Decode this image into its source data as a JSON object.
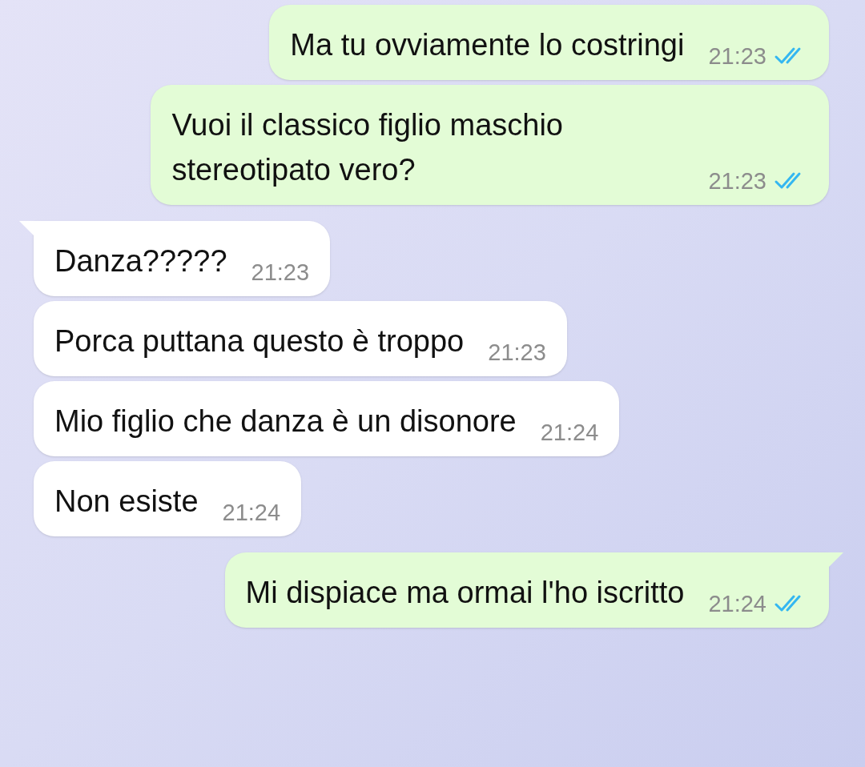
{
  "messages": [
    {
      "kind": "outgoing",
      "text": "Ma tu ovviamente lo costringi",
      "time": "21:23",
      "read": true,
      "tail": false
    },
    {
      "kind": "outgoing",
      "text": "Vuoi il classico figlio maschio stereotipato vero?",
      "time": "21:23",
      "read": true,
      "tail": false
    },
    {
      "kind": "incoming",
      "text": "Danza?????",
      "time": "21:23",
      "tail": true
    },
    {
      "kind": "incoming",
      "text": "Porca puttana questo è troppo",
      "time": "21:23",
      "tail": false
    },
    {
      "kind": "incoming",
      "text": "Mio figlio che danza è un disonore",
      "time": "21:24",
      "tail": false
    },
    {
      "kind": "incoming",
      "text": "Non esiste",
      "time": "21:24",
      "tail": false
    },
    {
      "kind": "outgoing",
      "text": "Mi dispiace ma ormai l'ho iscritto",
      "time": "21:24",
      "read": true,
      "tail": true
    }
  ]
}
